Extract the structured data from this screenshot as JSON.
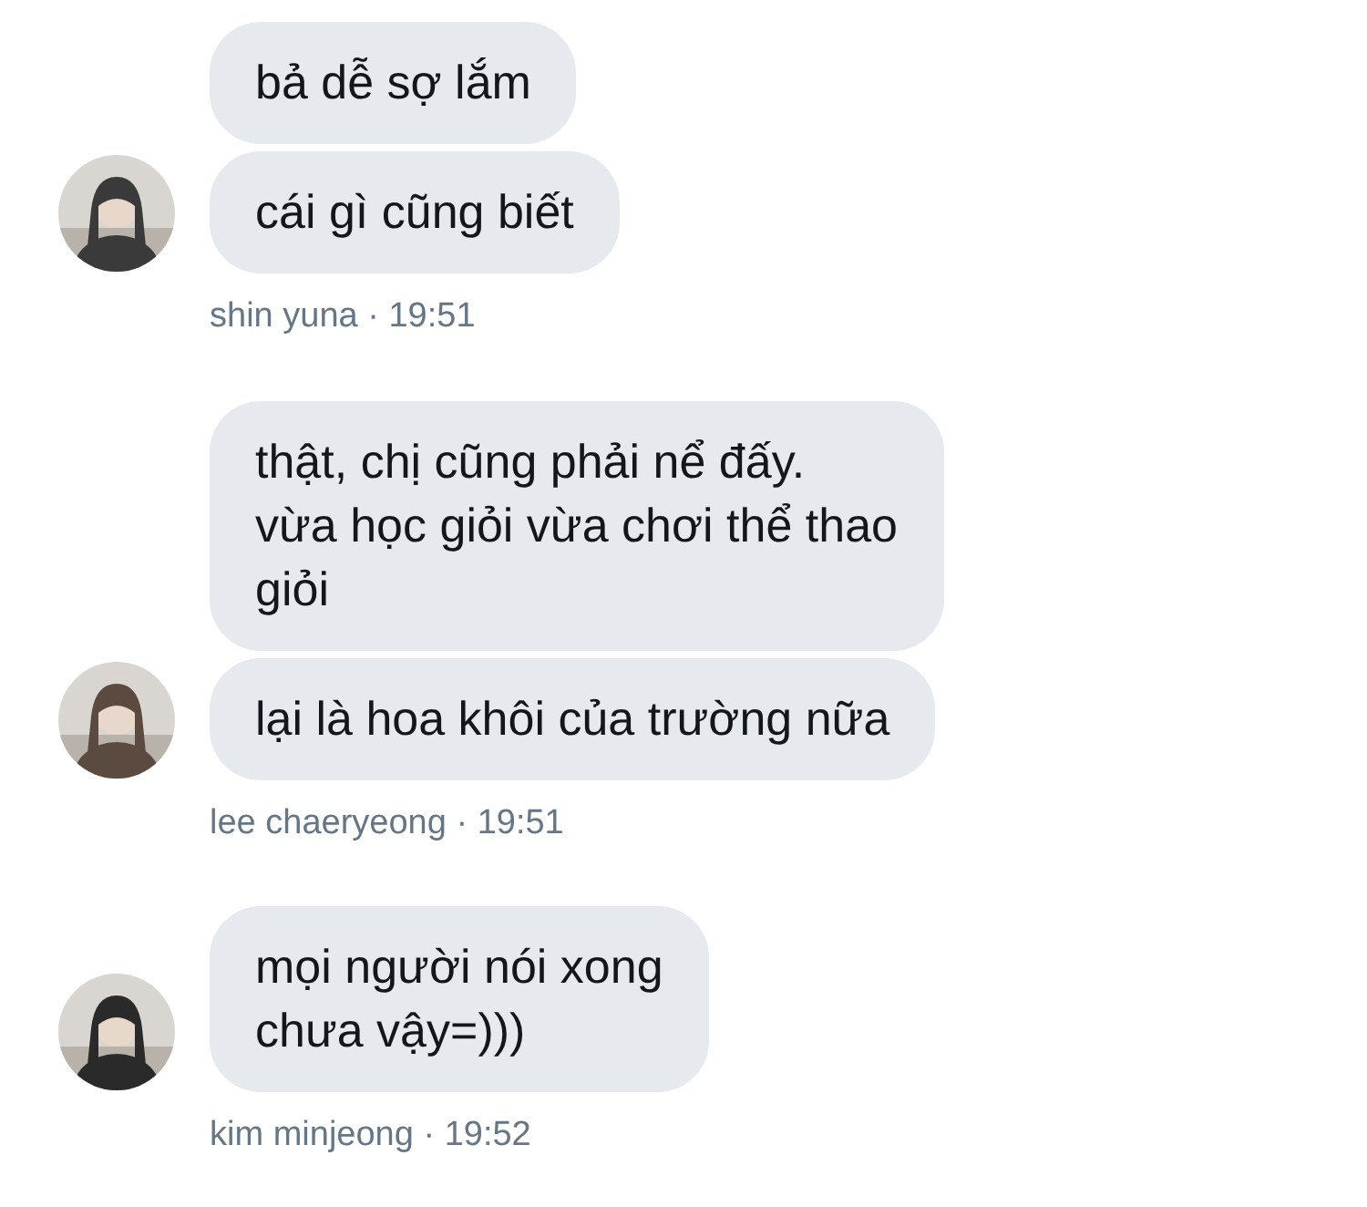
{
  "messages": [
    {
      "bubbles": [
        "bả dễ sợ lắm",
        "cái gì cũng biết"
      ],
      "meta": "shin yuna · 19:51",
      "avatar": {
        "kind": "picture"
      }
    },
    {
      "bubbles": [
        "thật, chị cũng phải nể đấy.\nvừa học giỏi vừa chơi thể thao\ngiỏi",
        "lại là hoa khôi của trường nữa"
      ],
      "meta": "lee chaeryeong · 19:51",
      "avatar": {
        "kind": "picture"
      }
    },
    {
      "bubbles": [
        "mọi người nói xong\nchưa vậy=)))"
      ],
      "meta": "kim minjeong · 19:52",
      "avatar": {
        "kind": "picture"
      }
    }
  ]
}
